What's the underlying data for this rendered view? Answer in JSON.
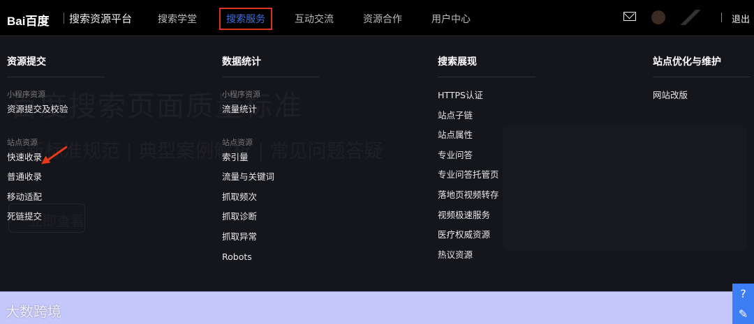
{
  "header": {
    "logo": "Bai百度",
    "title": "搜索资源平台",
    "nav": [
      "搜索学堂",
      "搜索服务",
      "互动交流",
      "资源合作",
      "用户中心"
    ],
    "active": "搜索服务",
    "logout": "退出"
  },
  "background": {
    "headline": "百度搜索页面质量标准",
    "subline": "最新标准规范 | 典型案例解析 | 常见问题答疑",
    "cta": "立即查看"
  },
  "menu": [
    {
      "title": "资源提交",
      "groups": [
        {
          "label": "小程序资源",
          "items": [
            "资源提交及校验"
          ]
        },
        {
          "label": "站点资源",
          "items": [
            "快速收录",
            "普通收录",
            "移动适配",
            "死链提交"
          ]
        }
      ]
    },
    {
      "title": "数据统计",
      "groups": [
        {
          "label": "小程序资源",
          "items": [
            "流量统计"
          ]
        },
        {
          "label": "站点资源",
          "items": [
            "索引量",
            "流量与关键词",
            "抓取频次",
            "抓取诊断",
            "抓取异常",
            "Robots"
          ]
        }
      ]
    },
    {
      "title": "搜索展现",
      "items": [
        "HTTPS认证",
        "站点子链",
        "站点属性",
        "专业问答",
        "专业问答托管页",
        "落地页视频转存",
        "视频极速服务",
        "医疗权威资源",
        "热议资源"
      ]
    },
    {
      "title": "站点优化与维护",
      "items": [
        "网站改版"
      ]
    }
  ],
  "watermark": "大数跨境",
  "side_icons": [
    "help-icon",
    "feedback-icon"
  ],
  "colors": {
    "accent": "#3b6fe0",
    "highlight": "#e0301e",
    "footer": "#c5c8fd"
  }
}
